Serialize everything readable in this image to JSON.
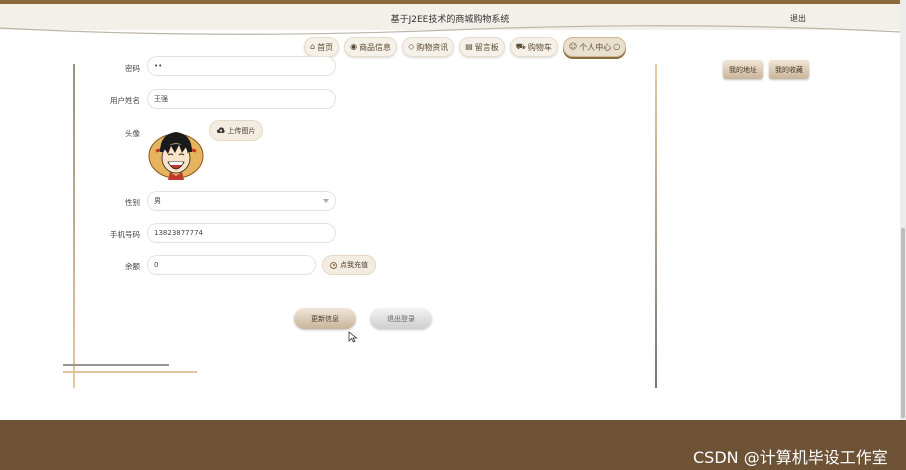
{
  "header": {
    "title": "基于J2EE技术的商城购物系统",
    "logout": "退出"
  },
  "nav": [
    {
      "label": "首页",
      "icon": "home-icon",
      "active": false
    },
    {
      "label": "商品信息",
      "icon": "eye-icon",
      "active": false
    },
    {
      "label": "购物资讯",
      "icon": "tag-icon",
      "active": false
    },
    {
      "label": "留言板",
      "icon": "note-icon",
      "active": false
    },
    {
      "label": "购物车",
      "icon": "cart-icon",
      "active": false
    },
    {
      "label": "个人中心",
      "icon": "user-icon",
      "active": true
    }
  ],
  "side_buttons": {
    "address": "我的地址",
    "favorites": "我的收藏"
  },
  "form": {
    "password": {
      "label": "密码",
      "value": "••"
    },
    "name": {
      "label": "用户姓名",
      "value": "王强"
    },
    "avatar": {
      "label": "头像",
      "upload_label": "上传图片"
    },
    "gender": {
      "label": "性别",
      "value": "男"
    },
    "phone": {
      "label": "手机号码",
      "value": "13823877774"
    },
    "balance": {
      "label": "余额",
      "value": "0",
      "recharge_label": "点我充值"
    }
  },
  "actions": {
    "update": "更新信息",
    "exit": "退出登录"
  },
  "watermark": "CSDN @计算机毕设工作室",
  "colors": {
    "brand": "#8b6a3e",
    "footer": "#6e5236"
  }
}
